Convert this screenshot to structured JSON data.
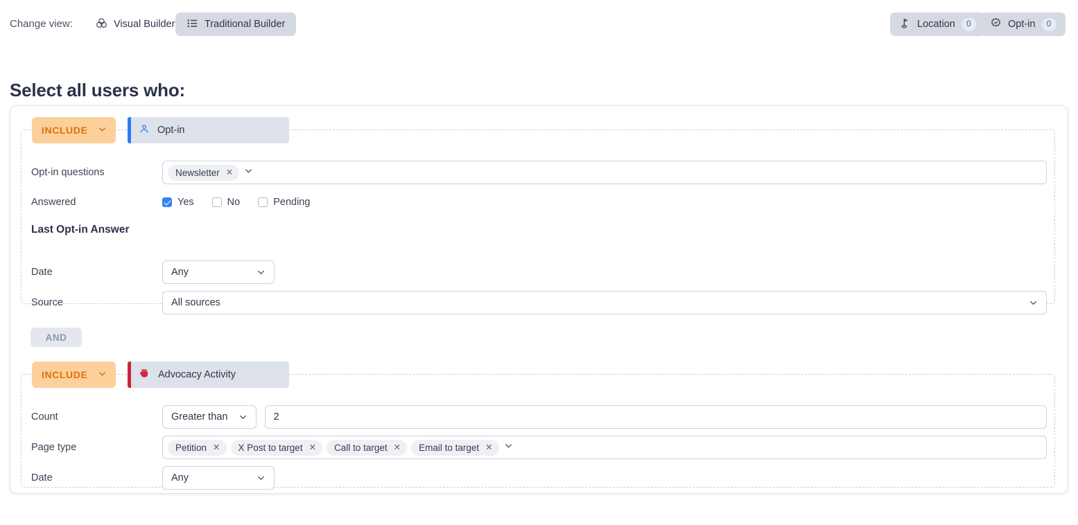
{
  "topbar": {
    "change_view_label": "Change view:",
    "views": [
      {
        "label": "Visual Builder",
        "icon": "venn-circles-icon",
        "active": false
      },
      {
        "label": "Traditional Builder",
        "icon": "bulleted-list-icon",
        "active": true
      }
    ],
    "actions": [
      {
        "label": "Location",
        "count": "0",
        "icon": "map-pin-flag-icon"
      },
      {
        "label": "Opt-in",
        "count": "0",
        "icon": "verified-seal-icon"
      }
    ]
  },
  "page_title": "Select all users who:",
  "connector": "AND",
  "colors": {
    "include_pill_bg": "#fcd09b",
    "include_pill_text": "#e1700c",
    "optin_accent": "#2f7bf6",
    "advocacy_accent": "#c8243c",
    "checkbox_checked": "#3385f5"
  },
  "filters": [
    {
      "mode": "INCLUDE",
      "entity": "Opt-in",
      "entity_icon": "user-icon",
      "subhead": "Last Opt-in Answer",
      "questions": {
        "label": "Opt-in questions",
        "tokens": [
          "Newsletter"
        ]
      },
      "answered": {
        "label": "Answered",
        "options": [
          {
            "label": "Yes",
            "checked": true
          },
          {
            "label": "No",
            "checked": false
          },
          {
            "label": "Pending",
            "checked": false
          }
        ]
      },
      "date": {
        "label": "Date",
        "value": "Any"
      },
      "source": {
        "label": "Source",
        "value": "All sources"
      }
    },
    {
      "mode": "INCLUDE",
      "entity": "Advocacy Activity",
      "entity_icon": "raised-fist-icon",
      "count": {
        "label": "Count",
        "operator": "Greater than",
        "value": "2"
      },
      "page_type": {
        "label": "Page type",
        "tokens": [
          "Petition",
          "X Post to target",
          "Call to target",
          "Email to target"
        ]
      },
      "date": {
        "label": "Date",
        "value": "Any"
      }
    }
  ]
}
